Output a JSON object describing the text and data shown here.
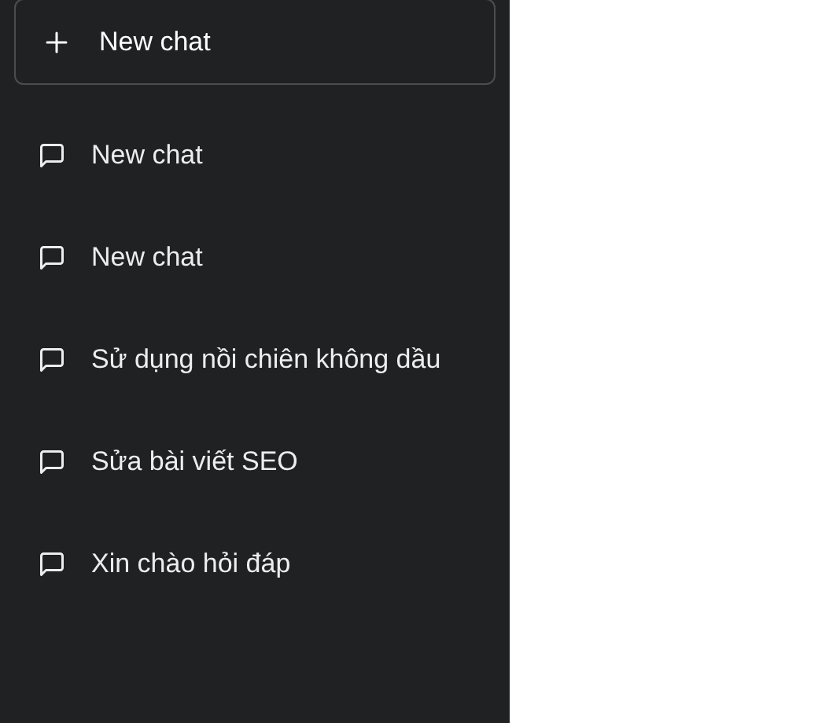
{
  "sidebar": {
    "new_chat_button": {
      "label": "New chat"
    },
    "items": [
      {
        "title": "New chat"
      },
      {
        "title": "New chat"
      },
      {
        "title": "Sử dụng nồi chiên không dầu"
      },
      {
        "title": "Sửa bài viết SEO"
      },
      {
        "title": "Xin chào hỏi đáp"
      }
    ]
  }
}
